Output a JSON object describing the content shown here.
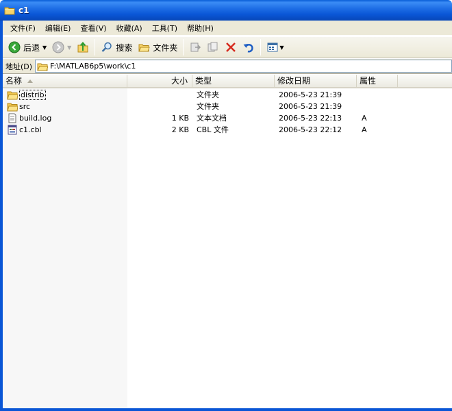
{
  "window": {
    "title": "c1"
  },
  "menu": [
    "文件(F)",
    "编辑(E)",
    "查看(V)",
    "收藏(A)",
    "工具(T)",
    "帮助(H)"
  ],
  "toolbar": {
    "back_label": "后退",
    "search_label": "搜索",
    "folders_label": "文件夹"
  },
  "address": {
    "label": "地址(D)",
    "path": "F:\\MATLAB6p5\\work\\c1"
  },
  "columns": {
    "name": "名称",
    "size": "大小",
    "type": "类型",
    "modified": "修改日期",
    "attributes": "属性"
  },
  "files": [
    {
      "name": "distrib",
      "size": "",
      "type": "文件夹",
      "modified": "2006-5-23 21:39",
      "attributes": "",
      "icon": "folder-icon"
    },
    {
      "name": "src",
      "size": "",
      "type": "文件夹",
      "modified": "2006-5-23 21:39",
      "attributes": "",
      "icon": "folder-icon"
    },
    {
      "name": "build.log",
      "size": "1 KB",
      "type": "文本文档",
      "modified": "2006-5-23 22:13",
      "attributes": "A",
      "icon": "text-file-icon"
    },
    {
      "name": "c1.cbl",
      "size": "2 KB",
      "type": "CBL 文件",
      "modified": "2006-5-23 22:12",
      "attributes": "A",
      "icon": "cbl-file-icon"
    }
  ],
  "colors": {
    "titlebar": "#0a56d6",
    "chrome": "#ece9d8",
    "sorted_column": "#f7f7f7"
  }
}
